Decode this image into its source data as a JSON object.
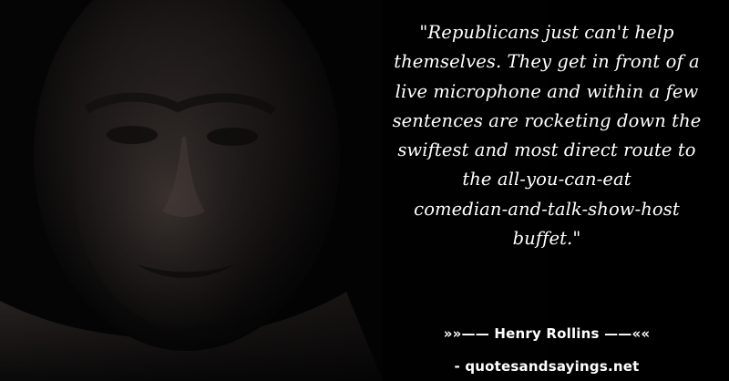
{
  "quote": {
    "lines": [
      "\"Republicans just can't help",
      "themselves. They get in front of a",
      "live microphone and within a few",
      "sentences are rocketing down the",
      "swiftest and most direct route to",
      "the all-you-can-eat",
      "comedian-and-talk-show-host",
      "buffet.\""
    ]
  },
  "attribution": "»»—— Henry Rollins ——««",
  "source": "- quotesandsayings.net"
}
